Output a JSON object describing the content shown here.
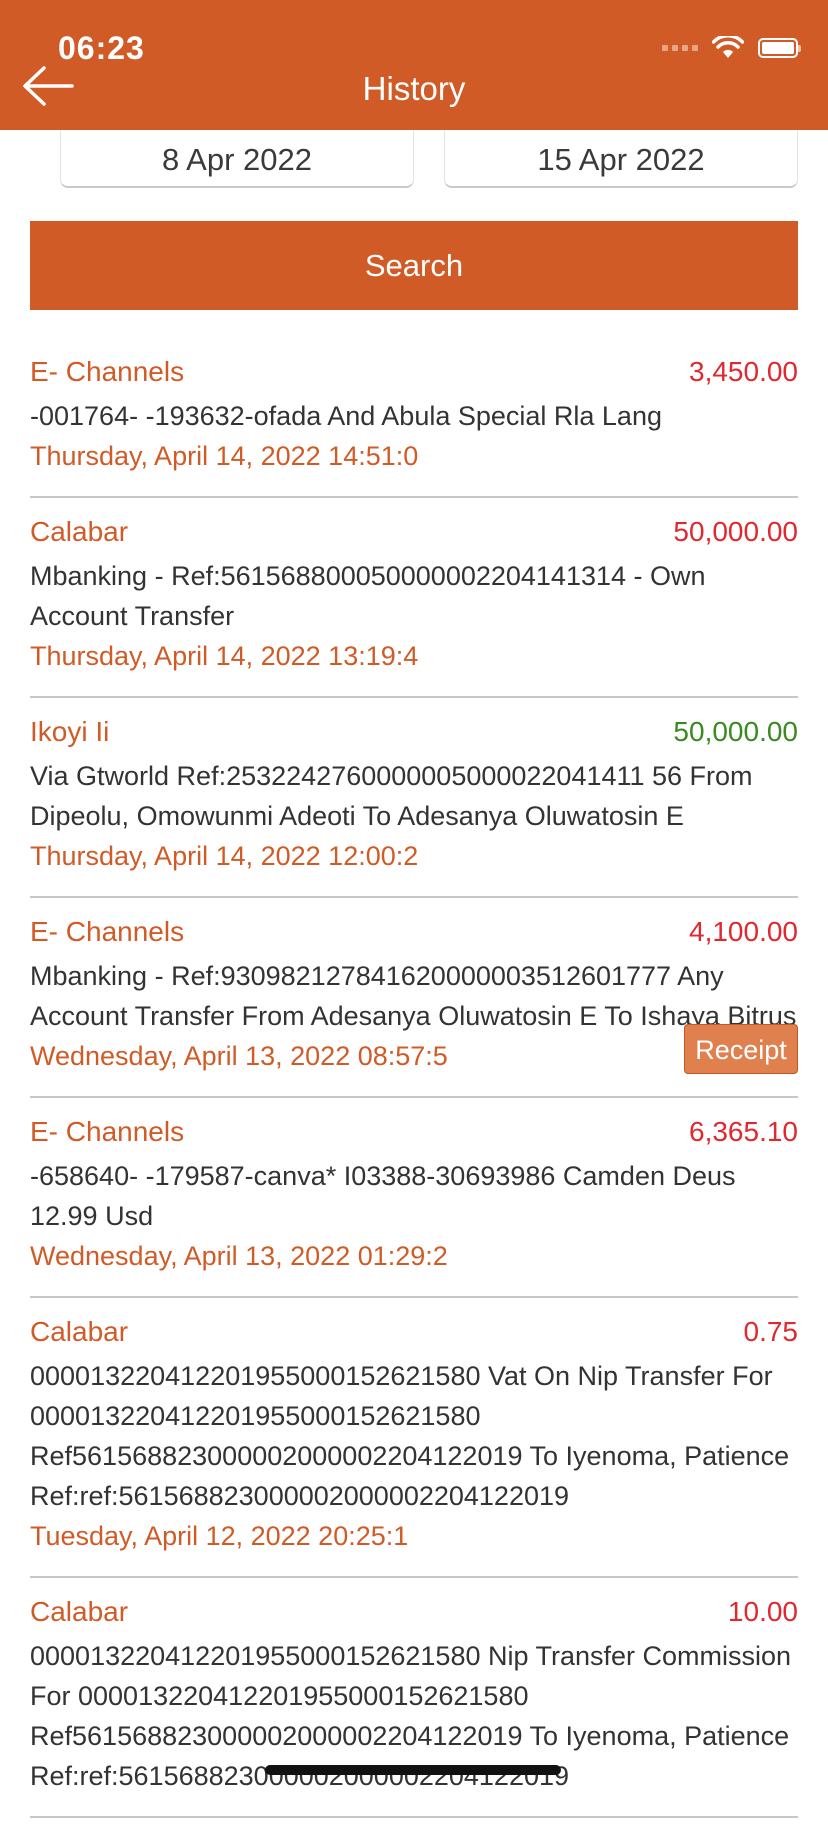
{
  "status_bar": {
    "time": "06:23"
  },
  "header": {
    "title": "History"
  },
  "filters": {
    "date_from": "8 Apr 2022",
    "date_to": "15 Apr 2022",
    "search_label": "Search"
  },
  "colors": {
    "brand": "#d05b27",
    "debit": "#e0282e",
    "credit": "#3a8a22"
  },
  "transactions": [
    {
      "channel": "E- Channels",
      "amount": "3,450.00",
      "type": "debit",
      "narration": "-001764- -193632-ofada And Abula Special Rla Lang",
      "date": "Thursday, April 14, 2022 14:51:0"
    },
    {
      "channel": "Calabar",
      "amount": "50,000.00",
      "type": "debit",
      "narration": "Mbanking - Ref:561568800050000002204141314 - Own Account Transfer",
      "date": "Thursday, April 14, 2022 13:19:4"
    },
    {
      "channel": "Ikoyi Ii",
      "amount": "50,000.00",
      "type": "credit",
      "narration": "Via Gtworld Ref:2532242760000005000022041411 56 From Dipeolu, Omowunmi Adeoti To Adesanya Oluwatosin E",
      "date": "Thursday, April 14, 2022 12:00:2"
    },
    {
      "channel": "E- Channels",
      "amount": "4,100.00",
      "type": "debit",
      "narration": "Mbanking - Ref:930982127841620000003512601777 Any Account Transfer From Adesanya Oluwatosin E To Ishaya Bitrus",
      "date": "Wednesday, April 13, 2022 08:57:5",
      "receipt_label": "Receipt"
    },
    {
      "channel": "E- Channels",
      "amount": "6,365.10",
      "type": "debit",
      "narration": "-658640- -179587-canva* I03388-30693986 Camden Deus 12.99 Usd",
      "date": "Wednesday, April 13, 2022 01:29:2"
    },
    {
      "channel": "Calabar",
      "amount": "0.75",
      "type": "debit",
      "narration": "000013220412201955000152621580 Vat On Nip Transfer For 000013220412201955000152621580 Ref561568823000002000002204122019 To Iyenoma, Patience Ref:ref:561568823000002000002204122019",
      "date": "Tuesday, April 12, 2022 20:25:1"
    },
    {
      "channel": "Calabar",
      "amount": "10.00",
      "type": "debit",
      "narration": "000013220412201955000152621580 Nip Transfer Commission For 000013220412201955000152621580 Ref561568823000002000002204122019 To Iyenoma, Patience Ref:ref:561568823000002000002204122019",
      "date": ""
    }
  ]
}
